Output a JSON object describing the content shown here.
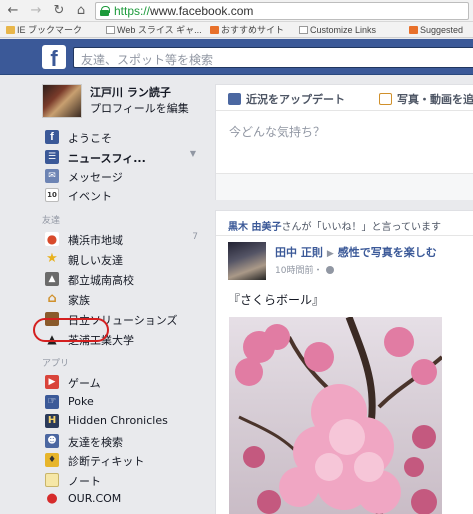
{
  "browser": {
    "url_scheme": "https://",
    "url_host": "www.facebook.com",
    "bookmarks": [
      {
        "label": "IE ブックマーク",
        "icon": "folder-icon"
      },
      {
        "label": "Web スライス ギャ...",
        "icon": "page-icon"
      },
      {
        "label": "おすすめサイト",
        "icon": "orange-icon"
      },
      {
        "label": "Customize Links",
        "icon": "page-icon"
      },
      {
        "label": "Suggested",
        "icon": "orange-icon"
      }
    ]
  },
  "header": {
    "logo": "f",
    "search_placeholder": "友達、スポット等を検索"
  },
  "profile": {
    "name": "江戸川 ラン読子",
    "edit": "プロフィールを編集"
  },
  "nav": [
    {
      "label": "ようこそ",
      "icon": "facebook-icon",
      "color": "#3b5998"
    },
    {
      "label": "ニュースフィ...",
      "icon": "news-feed-icon",
      "color": "#3b5998",
      "bold": true
    },
    {
      "label": "メッセージ",
      "icon": "messages-icon",
      "color": "#6d84b4"
    },
    {
      "label": "イベント",
      "icon": "calendar-icon",
      "color": "#d8d8d8",
      "count_text": "10"
    }
  ],
  "friends_section": "友達",
  "friends": [
    {
      "label": "横浜市地域",
      "count": "7",
      "icon": "place-pin-icon"
    },
    {
      "label": "親しい友達",
      "icon": "star-icon"
    },
    {
      "label": "都立城南高校",
      "icon": "school-icon"
    },
    {
      "label": "家族",
      "icon": "house-icon"
    },
    {
      "label": "日立ソリューションズ",
      "icon": "briefcase-icon"
    },
    {
      "label": "芝浦工業大学",
      "icon": "graduation-cap-icon"
    }
  ],
  "apps_section": "アプリ",
  "apps": [
    {
      "label": "ゲーム",
      "icon": "games-icon"
    },
    {
      "label": "Poke",
      "icon": "poke-icon"
    },
    {
      "label": "Hidden Chronicles",
      "icon": "hidden-chronicles-icon"
    },
    {
      "label": "友達を検索",
      "icon": "find-friends-icon"
    },
    {
      "label": "診断ティキット",
      "icon": "ticket-icon"
    },
    {
      "label": "ノート",
      "icon": "notes-icon"
    },
    {
      "label": "OUR.COM",
      "icon": "our-com-icon"
    }
  ],
  "composer": {
    "tab_status": "近況をアップデート",
    "tab_photo": "写真・動画を追",
    "prompt": "今どんな気持ち？"
  },
  "story": {
    "context_name": "黒木 由美子",
    "context_rest": "さんが「いいね！」と言っています",
    "author": "田中 正則",
    "activity": "感性で写真を楽しむ",
    "time": "10時間前・",
    "text": "『さくらボール』"
  }
}
